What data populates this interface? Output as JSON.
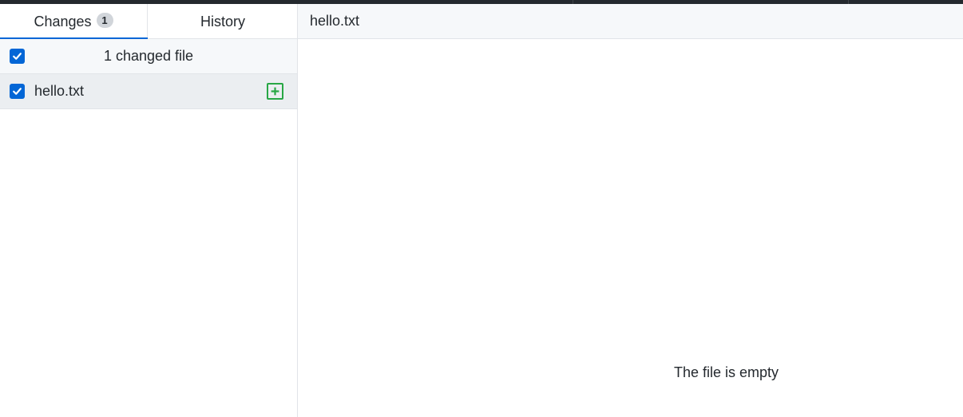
{
  "tabs": {
    "changes_label": "Changes",
    "changes_count": "1",
    "history_label": "History"
  },
  "changes_list": {
    "summary": "1 changed file",
    "select_all_checked": true,
    "files": [
      {
        "name": "hello.txt",
        "checked": true,
        "status": "added",
        "status_icon": "diff-added-icon"
      }
    ]
  },
  "diff": {
    "file_path": "hello.txt",
    "empty_message": "The file is empty"
  },
  "colors": {
    "accent": "#0366d6",
    "added": "#28a745",
    "topbar": "#24292e"
  }
}
